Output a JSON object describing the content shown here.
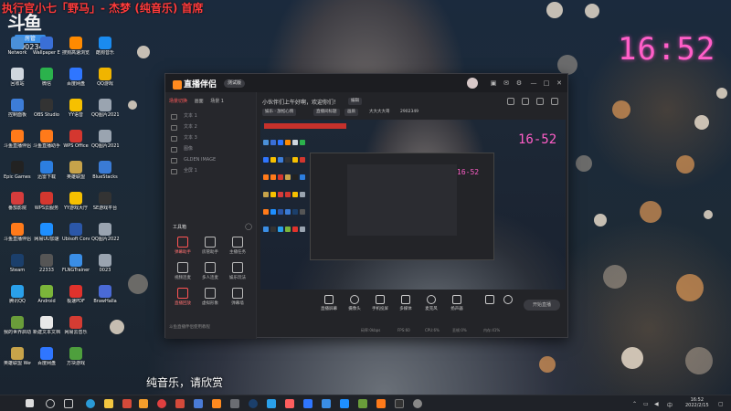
{
  "stream": {
    "title": "执行官小七「野马」- 杰梦 (纯音乐) 首席",
    "logo": "斗鱼",
    "room_badge": "房管",
    "room_id": "2902349",
    "clock": "16:52",
    "subtitle": "纯音乐，请欣赏"
  },
  "desktop_icons": [
    {
      "label": "Network",
      "color": "#4a90d9"
    },
    {
      "label": "回收站",
      "color": "#cfd6de"
    },
    {
      "label": "控制面板",
      "color": "#3d7dd8"
    },
    {
      "label": "斗鱼直播伴侣",
      "color": "#ff7a1a"
    },
    {
      "label": "Epic Games Launcher",
      "color": "#222"
    },
    {
      "label": "番茄影院",
      "color": "#d63c3c"
    },
    {
      "label": "斗鱼直播伴侣",
      "color": "#ff7a1a"
    },
    {
      "label": "Steam",
      "color": "#1b3f6b"
    },
    {
      "label": "腾讯QQ",
      "color": "#2aa0ea"
    },
    {
      "label": "我的世界启动器",
      "color": "#6a9d3a"
    },
    {
      "label": "英雄联盟 WeGame版",
      "color": "#c7a34a"
    },
    {
      "label": "Wallpaper Engine",
      "color": "#3a6fd6"
    },
    {
      "label": "微信",
      "color": "#2bb24c"
    },
    {
      "label": "OBS Studio",
      "color": "#333"
    },
    {
      "label": "斗鱼直播助手",
      "color": "#ff7a1a"
    },
    {
      "label": "迅雷下载",
      "color": "#2c7ee0"
    },
    {
      "label": "WPS云服务",
      "color": "#d4372f"
    },
    {
      "label": "网易UU加速",
      "color": "#1e8fff"
    },
    {
      "label": "22333",
      "color": "#555"
    },
    {
      "label": "Android",
      "color": "#7bb53a"
    },
    {
      "label": "新建文本文档",
      "color": "#e8e8e8"
    },
    {
      "label": "百度网盘",
      "color": "#2f76ff"
    },
    {
      "label": "搜狗高速浏览器",
      "color": "#ff8a00"
    },
    {
      "label": "百度网盘",
      "color": "#2f76ff"
    },
    {
      "label": "YY语音",
      "color": "#f6c000"
    },
    {
      "label": "WPS Office",
      "color": "#d4372f"
    },
    {
      "label": "英雄联盟",
      "color": "#c7a34a"
    },
    {
      "label": "YY游戏大厅",
      "color": "#f6c000"
    },
    {
      "label": "Ubisoft Connect",
      "color": "#2b57a8"
    },
    {
      "label": "FLNGTrainer",
      "color": "#3a8ee6"
    },
    {
      "label": "极速PDF",
      "color": "#e0322c"
    },
    {
      "label": "网易云音乐",
      "color": "#d43c33"
    },
    {
      "label": "方块游戏",
      "color": "#4e9f3d"
    },
    {
      "label": "酷狗音乐",
      "color": "#1a8bf0"
    },
    {
      "label": "QQ游戏",
      "color": "#f0b400"
    },
    {
      "label": "QQ图片20211230...",
      "color": "#9aa4b0"
    },
    {
      "label": "QQ图片20211230...",
      "color": "#9aa4b0"
    },
    {
      "label": "BlueStacks",
      "color": "#3a7bd5"
    },
    {
      "label": "SE游戏平台",
      "color": "#333"
    },
    {
      "label": "QQ图片20220215...",
      "color": "#9aa4b0"
    },
    {
      "label": "0023",
      "color": "#9aa4b0"
    },
    {
      "label": "BrawHalla",
      "color": "#4a6ad6"
    }
  ],
  "app": {
    "name": "直播伴侣",
    "version": "测试版",
    "side_tabs": [
      "场景切换",
      "画面",
      "场景 1"
    ],
    "scenes": [
      "文本 1",
      "文本 2",
      "文本 3",
      "图像",
      "GLDEN IMAGE",
      "全屏 1"
    ],
    "tools_title": "工具箱",
    "tools": [
      {
        "label": "弹幕助手",
        "active": true
      },
      {
        "label": "房管助手",
        "active": false
      },
      {
        "label": "主播任务",
        "active": false
      },
      {
        "label": "视频连麦",
        "active": false
      },
      {
        "label": "多人连麦",
        "active": false
      },
      {
        "label": "娱乐玩法",
        "active": false
      },
      {
        "label": "直播回放",
        "active": true
      },
      {
        "label": "虚拟形象",
        "active": false
      },
      {
        "label": "弹幕墙",
        "active": false
      }
    ],
    "side_footer": "斗鱼直播伴侣使用教程",
    "welcome": "小伙伴们上午好啊，欢迎你们！",
    "top_chips": [
      "编辑",
      "娱乐 · 放松心情",
      "直播间标题",
      "画质",
      "大大大大哥",
      "2902349"
    ],
    "preview_clock": "16-52",
    "preview_clock_2": "16-52",
    "bottom_buttons": [
      "直播屏幕",
      "摄像头",
      "手机投屏",
      "多媒体",
      "麦克风",
      "扬声器"
    ],
    "start_live": "开始直播",
    "status": [
      "码率:0kbps",
      "FPS:60",
      "CPU:6%",
      "丢帧:0%",
      "内存:41%"
    ]
  },
  "taskbar": {
    "time": "16:52",
    "date": "2022/2/15",
    "lang": "中"
  }
}
